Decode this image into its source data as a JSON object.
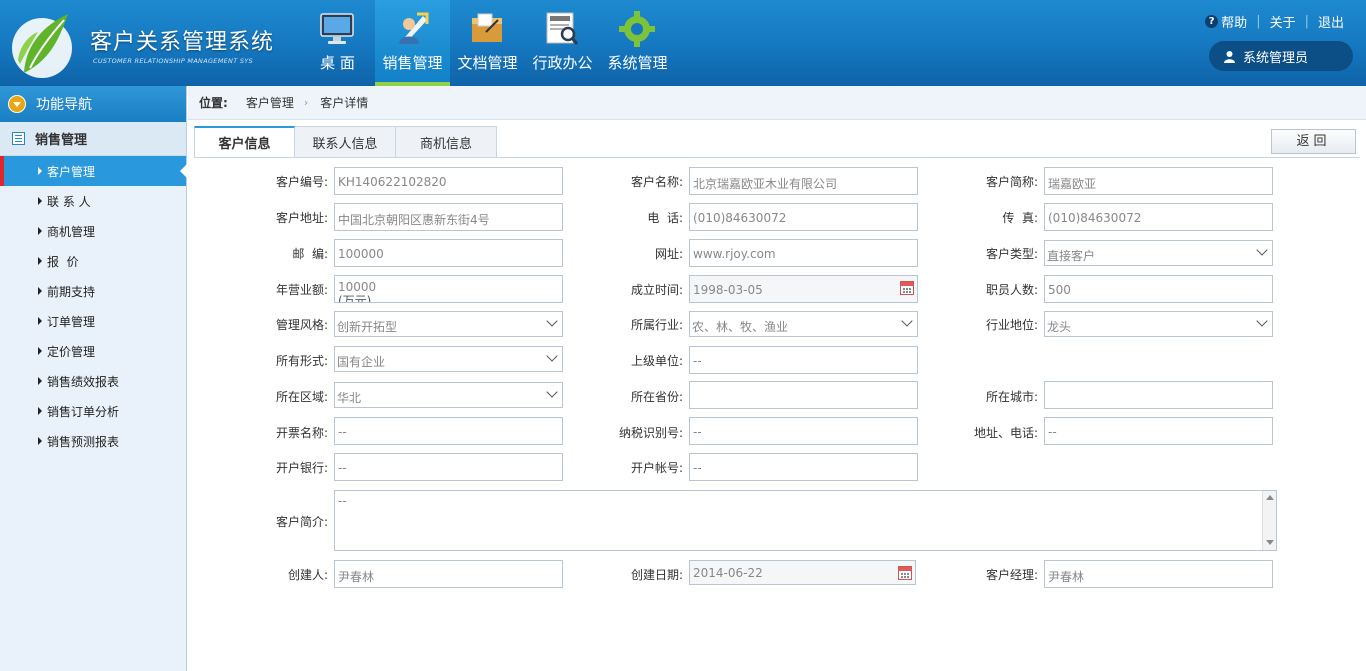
{
  "app": {
    "title": "客户关系管理系统",
    "subtitle": "CUSTOMER RELATIONSHIP MANAGEMENT SYS"
  },
  "nav": [
    {
      "label": "桌 面",
      "icon": "monitor-icon"
    },
    {
      "label": "销售管理",
      "icon": "sales-person-icon",
      "active": true
    },
    {
      "label": "文档管理",
      "icon": "document-box-icon"
    },
    {
      "label": "行政办公",
      "icon": "newspaper-icon"
    },
    {
      "label": "系统管理",
      "icon": "gear-icon"
    }
  ],
  "top_links": {
    "help": "帮助",
    "about": "关于",
    "logout": "退出"
  },
  "user": {
    "name": "系统管理员"
  },
  "sidebar": {
    "header": "功能导航",
    "group": "销售管理",
    "items": [
      {
        "label": "客户管理",
        "active": true
      },
      {
        "label": "联 系 人"
      },
      {
        "label": "商机管理"
      },
      {
        "label": "报  价"
      },
      {
        "label": "前期支持"
      },
      {
        "label": "订单管理"
      },
      {
        "label": "定价管理"
      },
      {
        "label": "销售绩效报表"
      },
      {
        "label": "销售订单分析"
      },
      {
        "label": "销售预测报表"
      }
    ]
  },
  "breadcrumb": {
    "prefix": "位置:",
    "items": [
      "客户管理",
      "客户详情"
    ]
  },
  "tabs": [
    "客户信息",
    "联系人信息",
    "商机信息"
  ],
  "back_button": "返回",
  "form": {
    "customer_no": {
      "label": "客户编号:",
      "value": "KH140622102820"
    },
    "customer_name": {
      "label": "客户名称:",
      "value": "北京瑞嘉欧亚木业有限公司"
    },
    "short_name": {
      "label": "客户简称:",
      "value": "瑞嘉欧亚"
    },
    "address": {
      "label": "客户地址:",
      "value": "中国北京朝阳区惠新东街4号"
    },
    "phone": {
      "label": "电  话:",
      "value": "(010)84630072"
    },
    "fax": {
      "label": "传  真:",
      "value": "(010)84630072"
    },
    "postcode": {
      "label": "邮  编:",
      "value": "100000"
    },
    "website": {
      "label": "网址:",
      "value": "www.rjoy.com"
    },
    "customer_type": {
      "label": "客户类型:",
      "value": "直接客户"
    },
    "annual_revenue": {
      "label": "年营业额:",
      "value": "10000",
      "unit": "(万元)"
    },
    "founded": {
      "label": "成立时间:",
      "value": "1998-03-05"
    },
    "employees": {
      "label": "职员人数:",
      "value": "500"
    },
    "mgmt_style": {
      "label": "管理风格:",
      "value": "创新开拓型"
    },
    "industry": {
      "label": "所属行业:",
      "value": "农、林、牧、渔业"
    },
    "industry_position": {
      "label": "行业地位:",
      "value": "龙头"
    },
    "ownership": {
      "label": "所有形式:",
      "value": "国有企业"
    },
    "parent_unit": {
      "label": "上级单位:",
      "value": "--"
    },
    "region": {
      "label": "所在区域:",
      "value": "华北"
    },
    "province": {
      "label": "所在省份:",
      "value": ""
    },
    "city": {
      "label": "所在城市:",
      "value": ""
    },
    "invoice_name": {
      "label": "开票名称:",
      "value": "--"
    },
    "tax_id": {
      "label": "纳税识别号:",
      "value": "--"
    },
    "invoice_addr_phone": {
      "label": "地址、电话:",
      "value": "--"
    },
    "bank": {
      "label": "开户银行:",
      "value": "--"
    },
    "account_no": {
      "label": "开户帐号:",
      "value": "--"
    },
    "intro": {
      "label": "客户简介:",
      "value": "--"
    },
    "creator": {
      "label": "创建人:",
      "value": "尹春林"
    },
    "created_date": {
      "label": "创建日期:",
      "value": "2014-06-22"
    },
    "manager": {
      "label": "客户经理:",
      "value": "尹春林"
    }
  },
  "colors": {
    "header": "#1577bf",
    "accent": "#2a98dc",
    "active_nav_underline": "#8fd24a",
    "active_marker": "#e0262c"
  }
}
